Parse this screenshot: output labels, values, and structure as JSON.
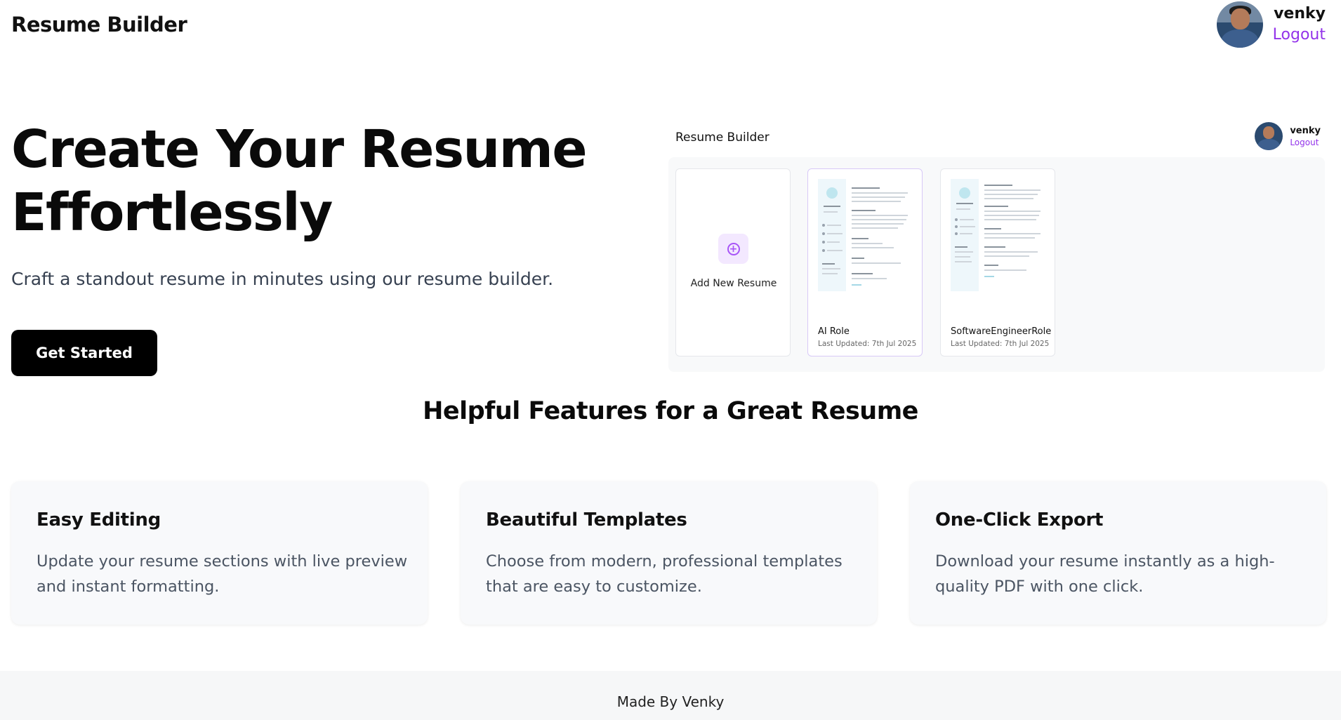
{
  "header": {
    "brand": "Resume Builder",
    "user_name": "venky",
    "logout_label": "Logout"
  },
  "hero": {
    "title": "Create Your Resume Effortlessly",
    "subtitle": "Craft a standout resume in minutes using our resume builder.",
    "cta_label": "Get Started"
  },
  "preview": {
    "brand": "Resume Builder",
    "user_name": "venky",
    "logout_label": "Logout",
    "add_label": "Add New Resume",
    "resumes": [
      {
        "title": "AI Role",
        "updated": "Last Updated: 7th Jul 2025"
      },
      {
        "title": "SoftwareEngineerRole",
        "updated": "Last Updated: 7th Jul 2025"
      }
    ]
  },
  "features": {
    "heading": "Helpful Features for a Great Resume",
    "items": [
      {
        "title": "Easy Editing",
        "description": "Update your resume sections with live preview and instant formatting."
      },
      {
        "title": "Beautiful Templates",
        "description": "Choose from modern, professional templates that are easy to customize."
      },
      {
        "title": "One-Click Export",
        "description": "Download your resume instantly as a high-quality PDF with one click."
      }
    ]
  },
  "footer": {
    "text": "Made By Venky"
  },
  "colors": {
    "accent": "#9333ea",
    "cta_bg": "#000000",
    "feature_bg": "#f8f9fb"
  },
  "icons": {
    "add_resume": "plus-circle-icon",
    "avatar": "user-avatar-icon"
  }
}
